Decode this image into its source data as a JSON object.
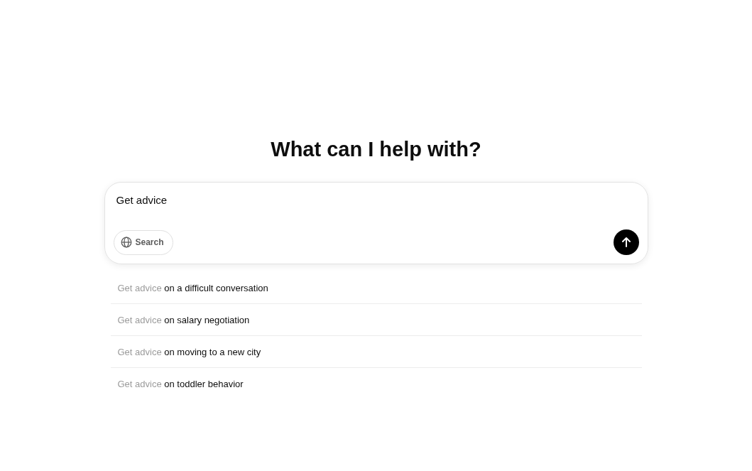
{
  "heading": "What can I help with?",
  "composer": {
    "value": "Get advice",
    "search_button": "Search"
  },
  "suggestions": [
    {
      "prefix": "Get advice",
      "text": "on a difficult conversation"
    },
    {
      "prefix": "Get advice",
      "text": "on salary negotiation"
    },
    {
      "prefix": "Get advice",
      "text": "on moving to a new city"
    },
    {
      "prefix": "Get advice",
      "text": "on toddler behavior"
    }
  ]
}
